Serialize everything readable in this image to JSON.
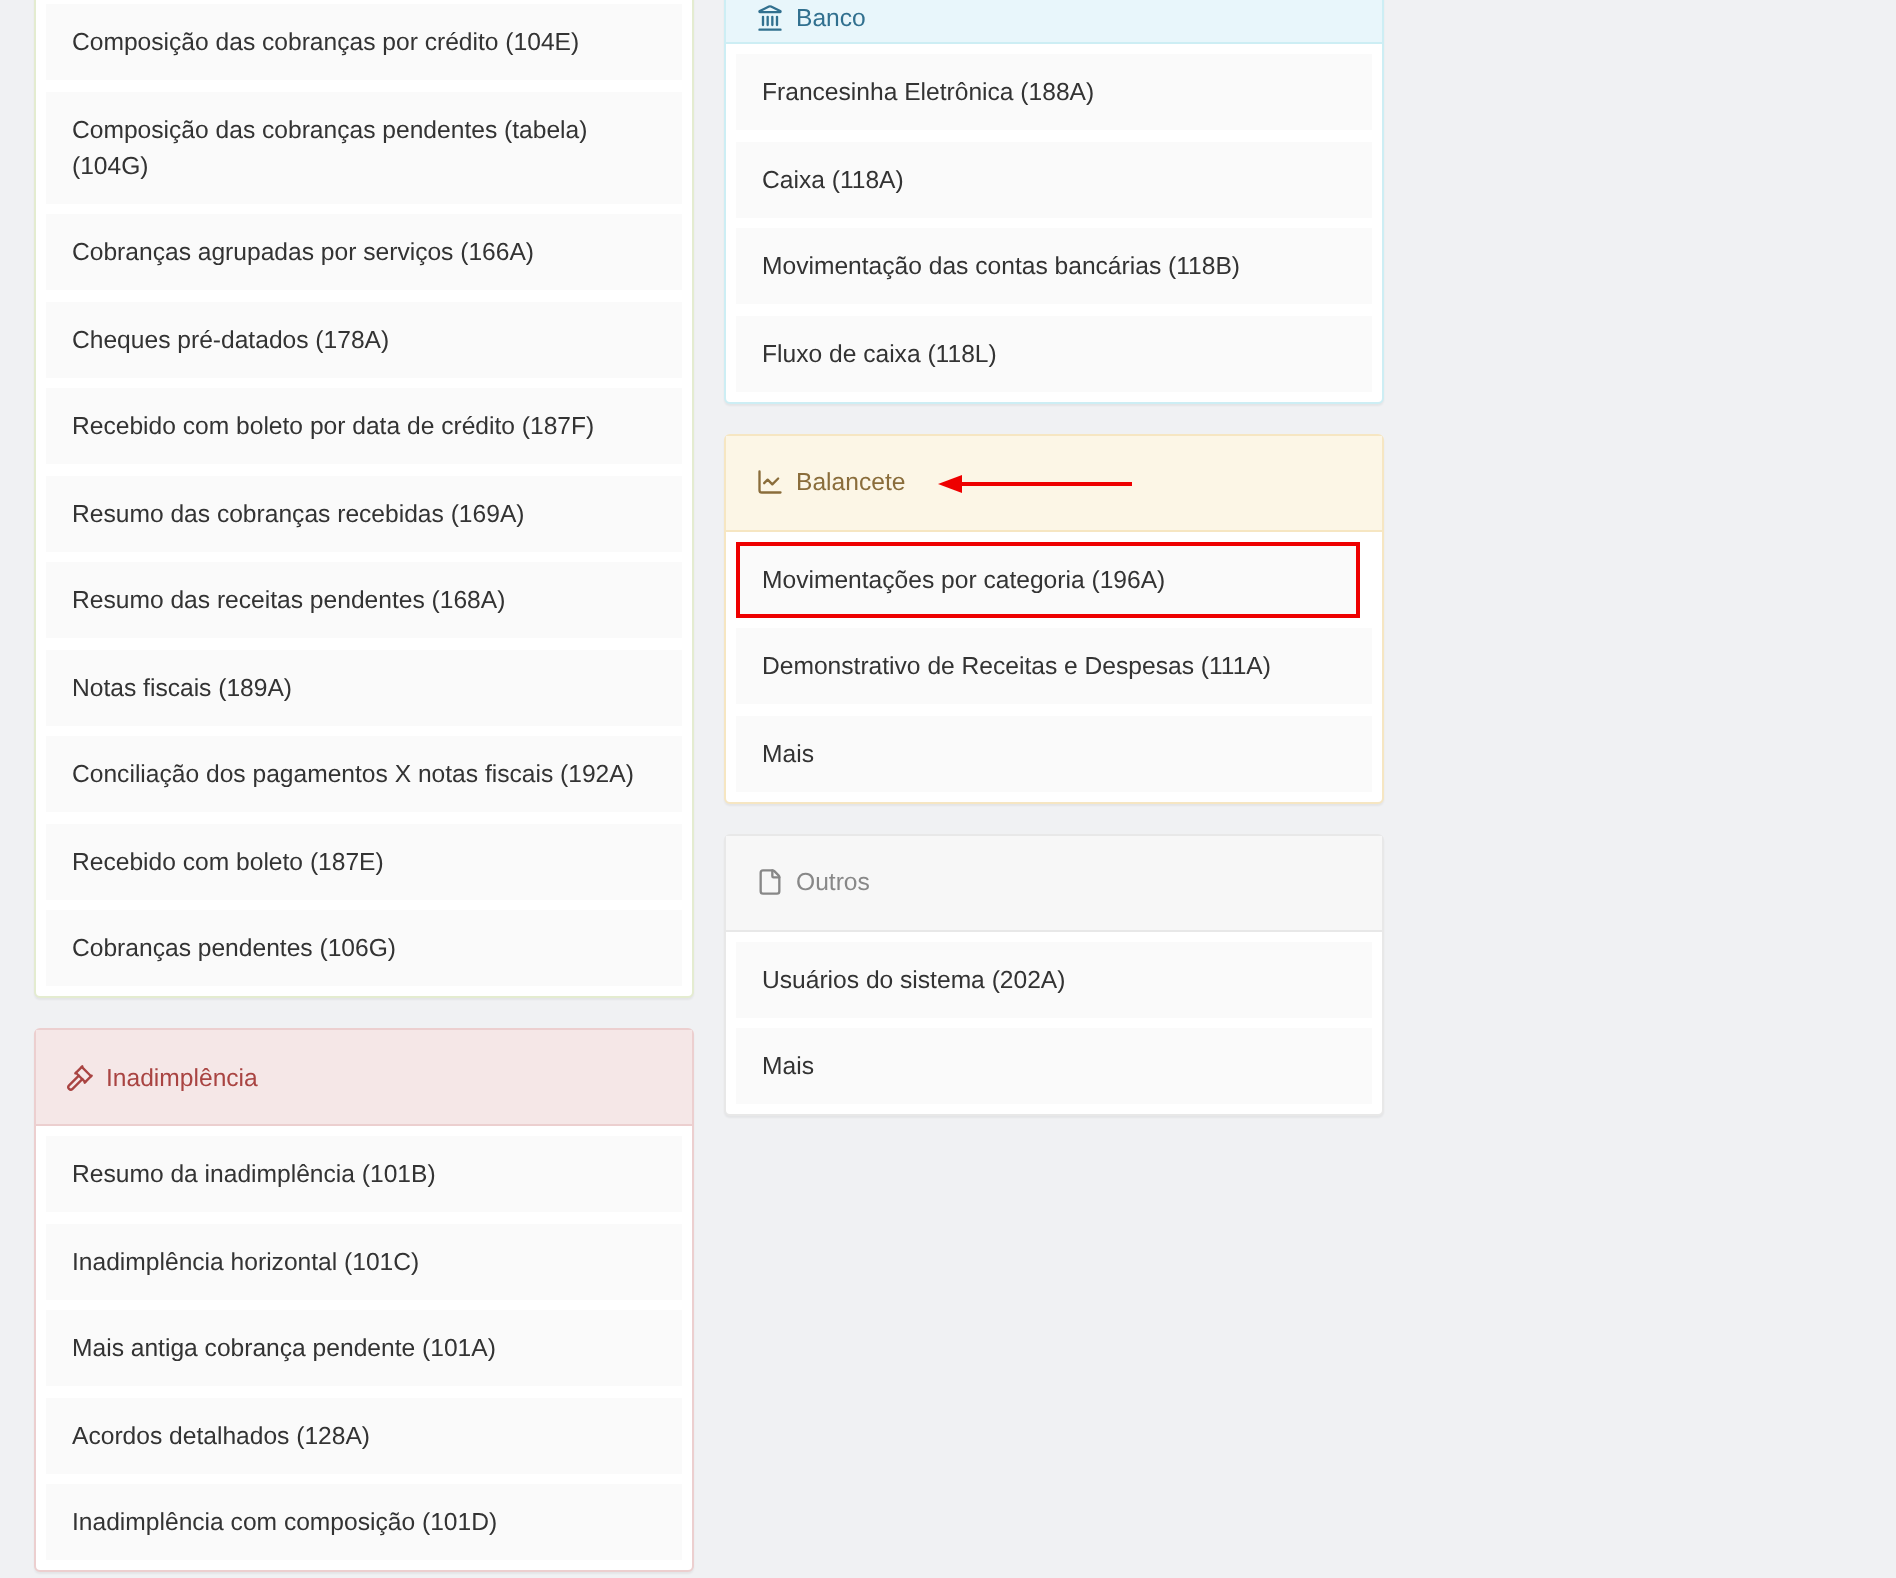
{
  "columns": [
    {
      "panels": [
        {
          "kind": "success",
          "pointer_arrow": false,
          "items": [
            {
              "label": "Composição das cobranças por crédito (104E)",
              "highlighted": false
            },
            {
              "label": "Composição das cobranças pendentes (tabela) (104G)",
              "highlighted": false
            },
            {
              "label": "Cobranças agrupadas por serviços (166A)",
              "highlighted": false
            },
            {
              "label": "Cheques pré-datados (178A)",
              "highlighted": false
            },
            {
              "label": "Recebido com boleto por data de crédito (187F)",
              "highlighted": false
            },
            {
              "label": "Resumo das cobranças recebidas (169A)",
              "highlighted": false
            },
            {
              "label": "Resumo das receitas pendentes (168A)",
              "highlighted": false
            },
            {
              "label": "Notas fiscais (189A)",
              "highlighted": false
            },
            {
              "label": "Conciliação dos pagamentos X notas fiscais (192A)",
              "highlighted": false
            },
            {
              "label": "Recebido com boleto (187E)",
              "highlighted": false
            },
            {
              "label": "Cobranças pendentes (106G)",
              "highlighted": false
            }
          ]
        },
        {
          "kind": "danger",
          "title": "Inadimplência",
          "pointer_arrow": false,
          "items": [
            {
              "label": "Resumo da inadimplência (101B)",
              "highlighted": false
            },
            {
              "label": "Inadimplência horizontal (101C)",
              "highlighted": false
            },
            {
              "label": "Mais antiga cobrança pendente (101A)",
              "highlighted": false
            },
            {
              "label": "Acordos detalhados (128A)",
              "highlighted": false
            },
            {
              "label": "Inadimplência com composição (101D)",
              "highlighted": false
            }
          ]
        }
      ]
    },
    {
      "panels": [
        {
          "kind": "info",
          "title": "Banco",
          "pointer_arrow": false,
          "items": [
            {
              "label": "Francesinha Eletrônica (188A)",
              "highlighted": false
            },
            {
              "label": "Caixa (118A)",
              "highlighted": false
            },
            {
              "label": "Movimentação das contas bancárias (118B)",
              "highlighted": false
            },
            {
              "label": "Fluxo de caixa (118L)",
              "highlighted": false
            }
          ]
        },
        {
          "kind": "warning",
          "title": "Balancete",
          "pointer_arrow": true,
          "items": [
            {
              "label": "Movimentações por categoria (196A)",
              "highlighted": true
            },
            {
              "label": "Demonstrativo de Receitas e Despesas (111A)",
              "highlighted": false
            },
            {
              "label": "Mais",
              "highlighted": false
            }
          ]
        },
        {
          "kind": "default",
          "title": "Outros",
          "pointer_arrow": false,
          "items": [
            {
              "label": "Usuários do sistema (202A)",
              "highlighted": false
            },
            {
              "label": "Mais",
              "highlighted": false
            }
          ]
        }
      ]
    }
  ]
}
